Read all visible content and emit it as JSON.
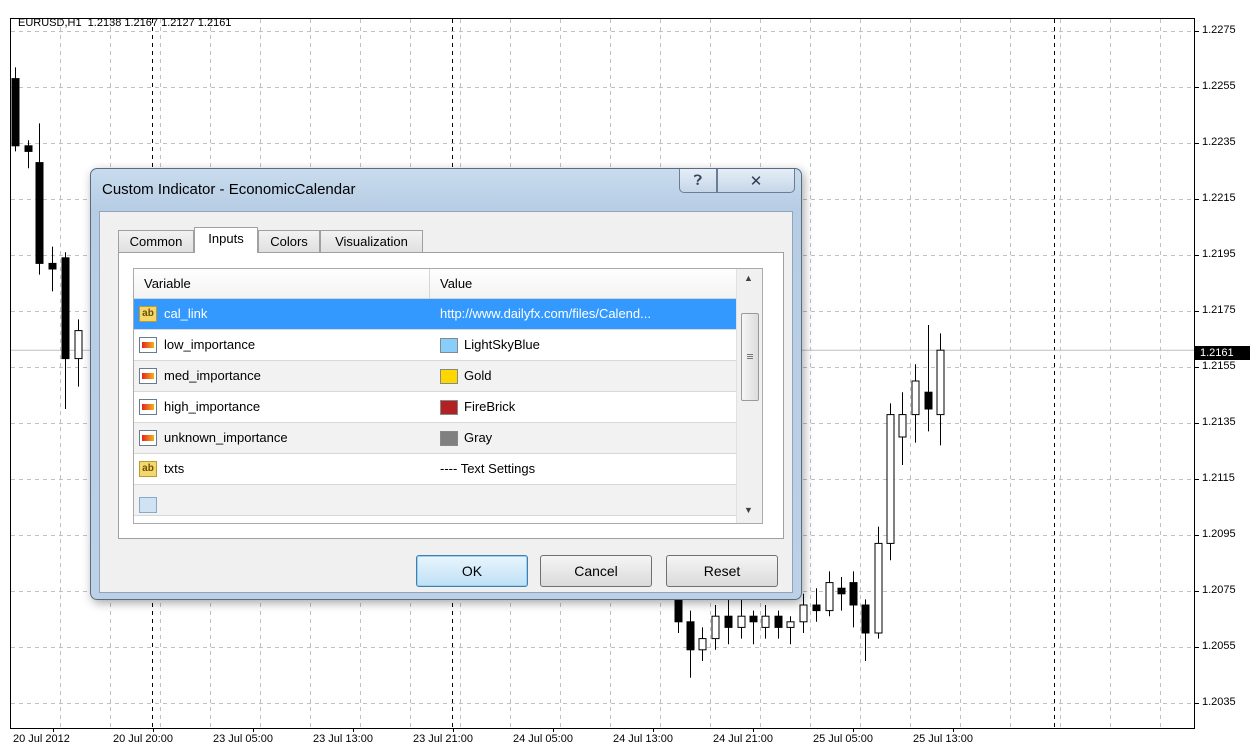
{
  "chart": {
    "symbol_info": "EURUSD,H1  1.2138 1.2167 1.2127 1.2161",
    "current_price": "1.2161",
    "price_axis": [
      "1.2275",
      "1.2255",
      "1.2235",
      "1.2215",
      "1.2195",
      "1.2175",
      "1.2155",
      "1.2135",
      "1.2115",
      "1.2095",
      "1.2075",
      "1.2055",
      "1.2035"
    ],
    "time_axis": [
      "20 Jul 2012",
      "20 Jul 20:00",
      "23 Jul 05:00",
      "23 Jul 13:00",
      "23 Jul 21:00",
      "24 Jul 05:00",
      "24 Jul 13:00",
      "24 Jul 21:00",
      "25 Jul 05:00",
      "25 Jul 13:00"
    ],
    "colors": {
      "background": "#ffffff",
      "grid": "#c0c0c0",
      "candle_bull": "#ffffff",
      "candle_bear": "#000000"
    }
  },
  "dialog": {
    "title": "Custom Indicator - EconomicCalendar",
    "help_icon": "question-mark-icon",
    "close_icon": "close-icon",
    "tabs": [
      {
        "label": "Common",
        "active": false
      },
      {
        "label": "Inputs",
        "active": true
      },
      {
        "label": "Colors",
        "active": false
      },
      {
        "label": "Visualization",
        "active": false
      }
    ],
    "grid": {
      "columns": [
        "Variable",
        "Value"
      ],
      "rows": [
        {
          "icon": "ab",
          "variable": "cal_link",
          "value": "http://www.dailyfx.com/files/Calend...",
          "selected": true
        },
        {
          "icon": "color",
          "variable": "low_importance",
          "value": "LightSkyBlue",
          "swatch": "#87cefa"
        },
        {
          "icon": "color",
          "variable": "med_importance",
          "value": "Gold",
          "swatch": "#ffd700"
        },
        {
          "icon": "color",
          "variable": "high_importance",
          "value": "FireBrick",
          "swatch": "#b22222"
        },
        {
          "icon": "color",
          "variable": "unknown_importance",
          "value": "Gray",
          "swatch": "#808080"
        },
        {
          "icon": "ab",
          "variable": "txts",
          "value": "---- Text Settings"
        }
      ]
    },
    "buttons": {
      "ok": "OK",
      "cancel": "Cancel",
      "reset": "Reset"
    }
  }
}
